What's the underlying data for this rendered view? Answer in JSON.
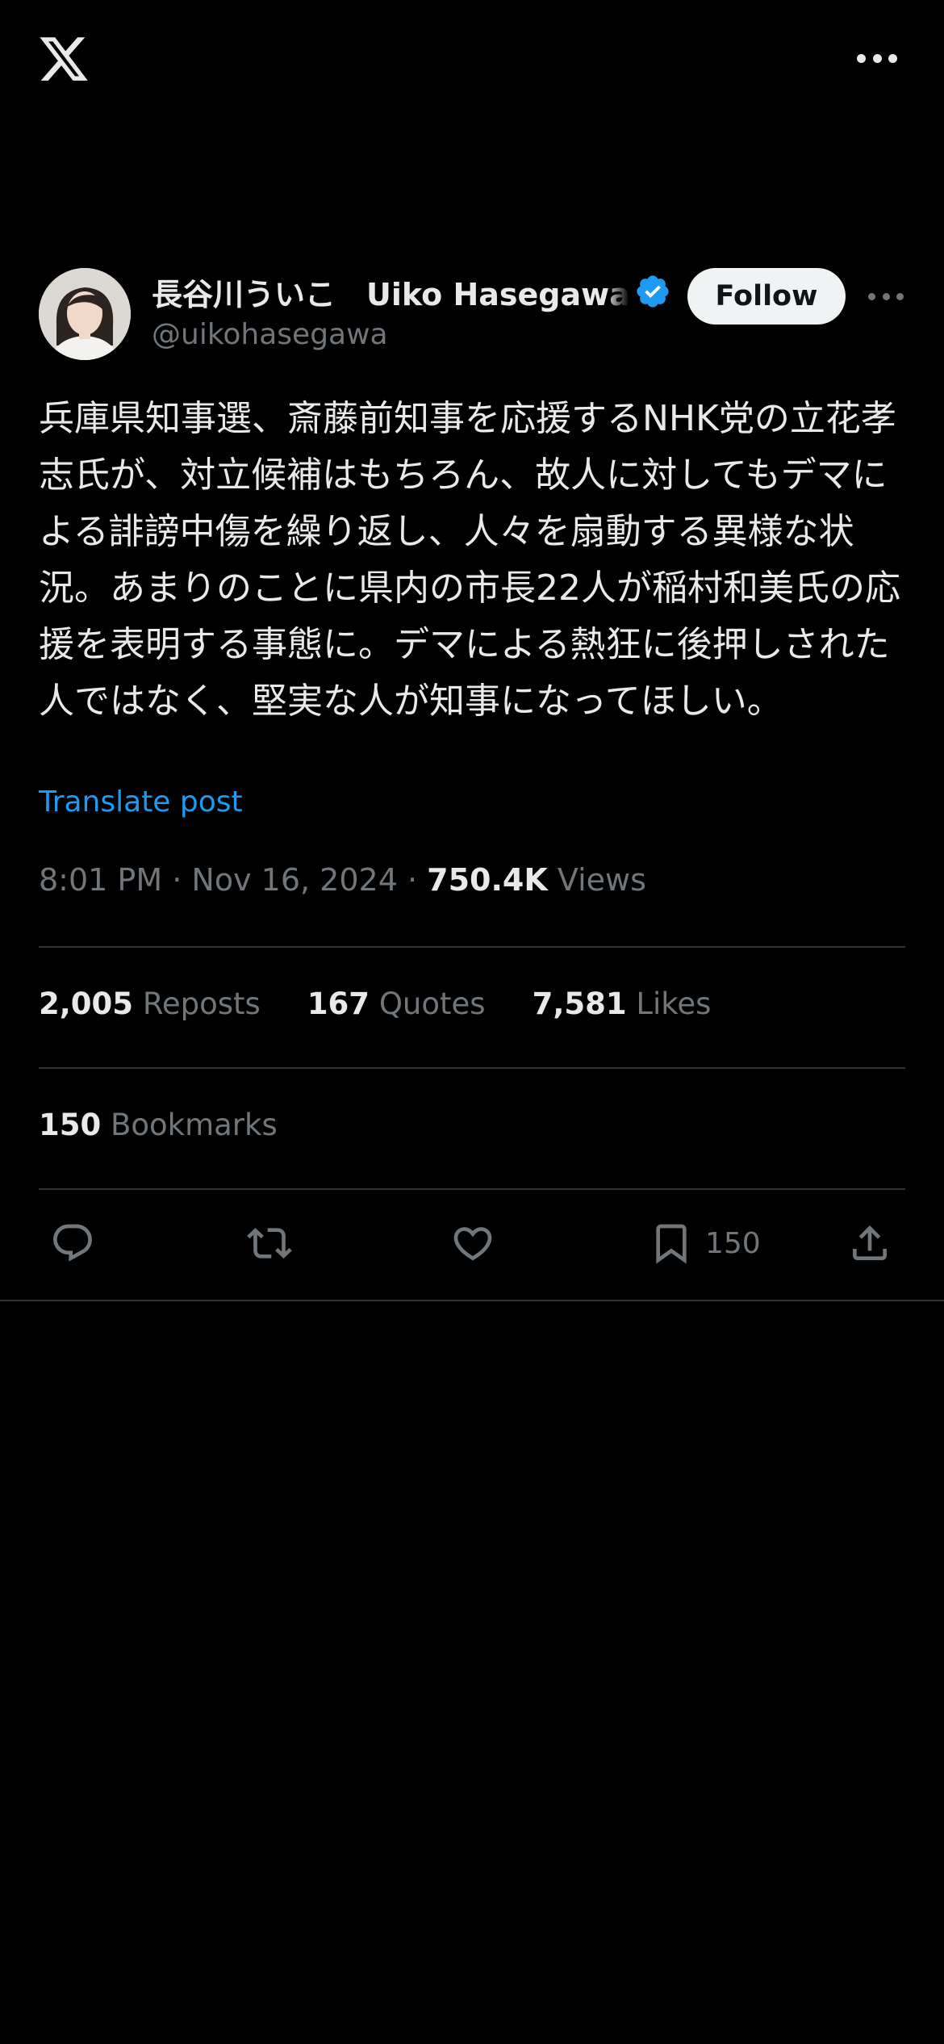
{
  "header": {
    "logo_icon": "x-logo-icon",
    "more_icon": "more-horizontal-icon"
  },
  "author": {
    "display_name": "長谷川ういこ　Uiko Hasegawa",
    "handle": "@uikohasegawa",
    "verified_color": "#1d9bf0",
    "follow_label": "Follow"
  },
  "post": {
    "text": "兵庫県知事選、斎藤前知事を応援するNHK党の立花孝志氏が、対立候補はもちろん、故人に対してもデマによる誹謗中傷を繰り返し、人々を扇動する異様な状況。あまりのことに県内の市長22人が稲村和美氏の応援を表明する事態に。デマによる熱狂に後押しされた人ではなく、堅実な人が知事になってほしい。",
    "translate_label": "Translate post",
    "time": "8:01 PM",
    "separator": "·",
    "date": "Nov 16, 2024",
    "views_count": "750.4K",
    "views_label": "Views"
  },
  "stats": {
    "reposts_count": "2,005",
    "reposts_label": "Reposts",
    "quotes_count": "167",
    "quotes_label": "Quotes",
    "likes_count": "7,581",
    "likes_label": "Likes",
    "bookmarks_count": "150",
    "bookmarks_label": "Bookmarks"
  },
  "actions": {
    "bookmark_count": "150",
    "icons": [
      "reply-icon",
      "repost-icon",
      "like-icon",
      "bookmark-icon",
      "share-icon"
    ]
  },
  "colors": {
    "background": "#000000",
    "text": "#e7e9ea",
    "secondary": "#71767b",
    "link": "#1d9bf0",
    "divider": "#2f3336"
  }
}
